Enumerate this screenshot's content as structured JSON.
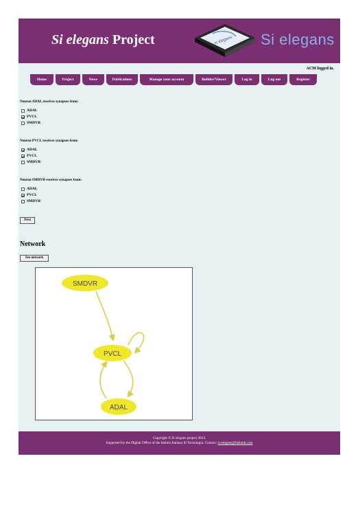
{
  "header": {
    "title_italic": "Si elegans",
    "title_rest": " Project",
    "chip_label": "si elegans",
    "brand_text": "Si elegans",
    "colors": {
      "banner": "#7a2f72",
      "brand": "#8ab0e8"
    }
  },
  "user": {
    "status": "ACM logged in."
  },
  "nav": {
    "items": [
      {
        "label": "Home"
      },
      {
        "label": "Project"
      },
      {
        "label": "News"
      },
      {
        "label": "Publications"
      },
      {
        "label": "Manage your account"
      },
      {
        "label": "Builder/Viewer"
      },
      {
        "label": "Log in"
      },
      {
        "label": "Log out"
      },
      {
        "label": "Register"
      }
    ]
  },
  "questions": [
    {
      "text": "Neuron ADAL receives synapses from:",
      "options": [
        {
          "label": "ADAL",
          "checked": false
        },
        {
          "label": "PVCL",
          "checked": true
        },
        {
          "label": "SMDVR",
          "checked": false
        }
      ]
    },
    {
      "text": "Neuron PVCL receives synapses from:",
      "options": [
        {
          "label": "ADAL",
          "checked": true
        },
        {
          "label": "PVCL",
          "checked": true
        },
        {
          "label": "SMDVR",
          "checked": false
        }
      ]
    },
    {
      "text": "Neuron SMDVR receives synapses from:",
      "options": [
        {
          "label": "ADAL",
          "checked": false
        },
        {
          "label": "PVCL",
          "checked": true
        },
        {
          "label": "SMDVR",
          "checked": false
        }
      ]
    }
  ],
  "next_button": "Next",
  "network": {
    "heading": "Network",
    "see_button": "See network",
    "nodes": [
      "SMDVR",
      "PVCL",
      "ADAL"
    ],
    "edges": [
      {
        "from": "SMDVR",
        "to": "PVCL"
      },
      {
        "from": "PVCL",
        "to": "PVCL"
      },
      {
        "from": "PVCL",
        "to": "ADAL"
      },
      {
        "from": "ADAL",
        "to": "PVCL"
      }
    ],
    "colors": {
      "node": "#f0e62a",
      "node_text": "#4a4a4a",
      "edge": "#d8cf4a"
    }
  },
  "footer": {
    "line1_prefix": "Copyright © ",
    "line1_italic": "Si elegans",
    "line1_suffix": " project 2013.",
    "line2_text": "Supported by the Digital Office of the Istituto Italiano di Tecnologia. Contact: ",
    "contact_email": "si-elegans@iitfrank.com"
  }
}
